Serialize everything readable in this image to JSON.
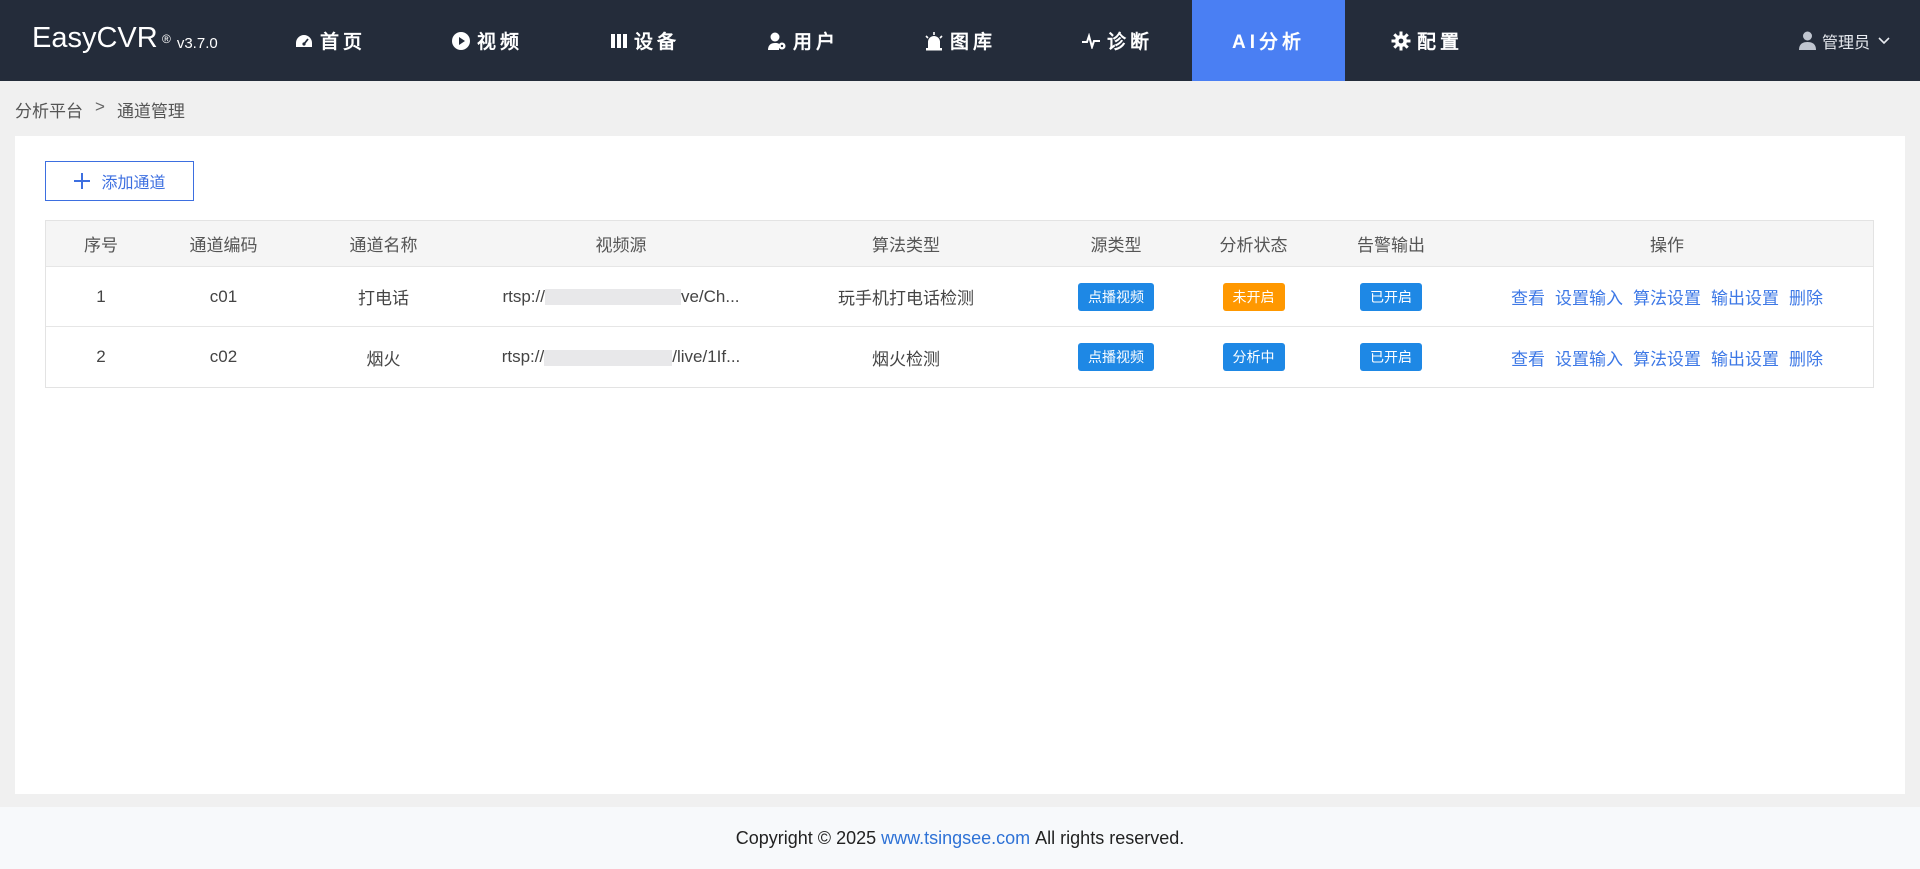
{
  "header": {
    "brand": "EasyCVR",
    "reg_mark": "®",
    "version": "v3.7.0",
    "nav": [
      {
        "label": "首页",
        "icon": "dashboard-icon"
      },
      {
        "label": "视频",
        "icon": "play-circle-icon"
      },
      {
        "label": "设备",
        "icon": "device-icon"
      },
      {
        "label": "用户",
        "icon": "user-gear-icon"
      },
      {
        "label": "图库",
        "icon": "alarm-light-icon"
      },
      {
        "label": "诊断",
        "icon": "pulse-icon"
      },
      {
        "label": "AI分析",
        "icon": "",
        "active": true
      },
      {
        "label": "配置",
        "icon": "gear-icon"
      }
    ],
    "user": "管理员"
  },
  "breadcrumb": {
    "parent": "分析平台",
    "separator": ">",
    "current": "通道管理"
  },
  "toolbar": {
    "add_label": "添加通道"
  },
  "table": {
    "columns": [
      "序号",
      "通道编码",
      "通道名称",
      "视频源",
      "算法类型",
      "源类型",
      "分析状态",
      "告警输出",
      "操作"
    ],
    "rows": [
      {
        "index": "1",
        "code": "c01",
        "name": "打电话",
        "source_prefix": "rtsp://",
        "source_suffix": "ve/Ch...",
        "algorithm": "玩手机打电话检测",
        "source_type": "点播视频",
        "status": "未开启",
        "alarm": "已开启"
      },
      {
        "index": "2",
        "code": "c02",
        "name": "烟火",
        "source_prefix": "rtsp://",
        "source_suffix": "/live/1If...",
        "algorithm": "烟火检测",
        "source_type": "点播视频",
        "status": "分析中",
        "alarm": "已开启"
      }
    ],
    "actions": [
      "查看",
      "设置输入",
      "算法设置",
      "输出设置",
      "删除"
    ]
  },
  "colors": {
    "source_type": "#1e88e5",
    "status_off": "#ff9800",
    "status_running": "#1e88e5",
    "alarm_on": "#1e88e5",
    "accent": "#4a7ff3"
  },
  "footer": {
    "prefix": "Copyright © 2025",
    "link": "www.tsingsee.com",
    "suffix": "All rights reserved."
  }
}
